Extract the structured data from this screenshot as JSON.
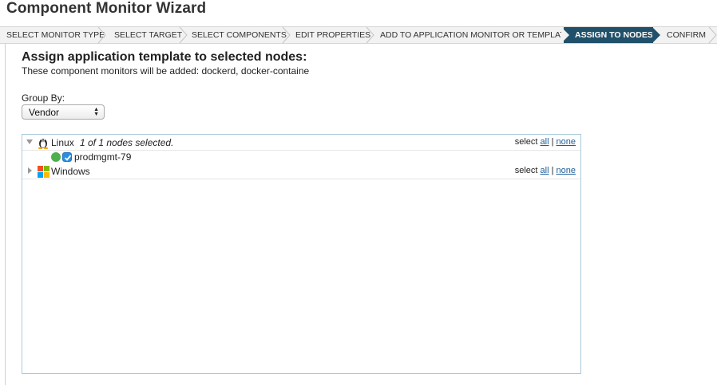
{
  "wizard": {
    "title": "Component Monitor Wizard"
  },
  "steps": [
    {
      "label": "SELECT MONITOR TYPE",
      "active": false
    },
    {
      "label": "SELECT TARGET",
      "active": false
    },
    {
      "label": "SELECT COMPONENTS",
      "active": false
    },
    {
      "label": "EDIT PROPERTIES",
      "active": false
    },
    {
      "label": "ADD TO APPLICATION MONITOR OR TEMPLATE",
      "active": false
    },
    {
      "label": "ASSIGN TO NODES",
      "active": true
    },
    {
      "label": "CONFIRM",
      "active": false
    }
  ],
  "main": {
    "heading": "Assign application template to selected nodes:",
    "subtext": "These component monitors will be added: dockerd, docker-containe",
    "group_by_label": "Group By:",
    "group_by_value": "Vendor"
  },
  "tree": {
    "groups": [
      {
        "name": "Linux",
        "status": "1 of 1 nodes selected.",
        "icon": "linux-penguin-icon",
        "expanded": true,
        "select_prefix": "select",
        "select_all": "all",
        "separator": "|",
        "select_none": "none",
        "nodes": [
          {
            "name": "prodmgmt-79",
            "status_color": "#4cb04c",
            "checked": true
          }
        ]
      },
      {
        "name": "Windows",
        "status": "",
        "icon": "windows-logo-icon",
        "expanded": false,
        "select_prefix": "select",
        "select_all": "all",
        "separator": "|",
        "select_none": "none",
        "nodes": []
      }
    ]
  },
  "colors": {
    "active_step": "#21506a",
    "link": "#1c5d99",
    "tree_border": "#a8c8dc",
    "node_up": "#4cb04c"
  }
}
